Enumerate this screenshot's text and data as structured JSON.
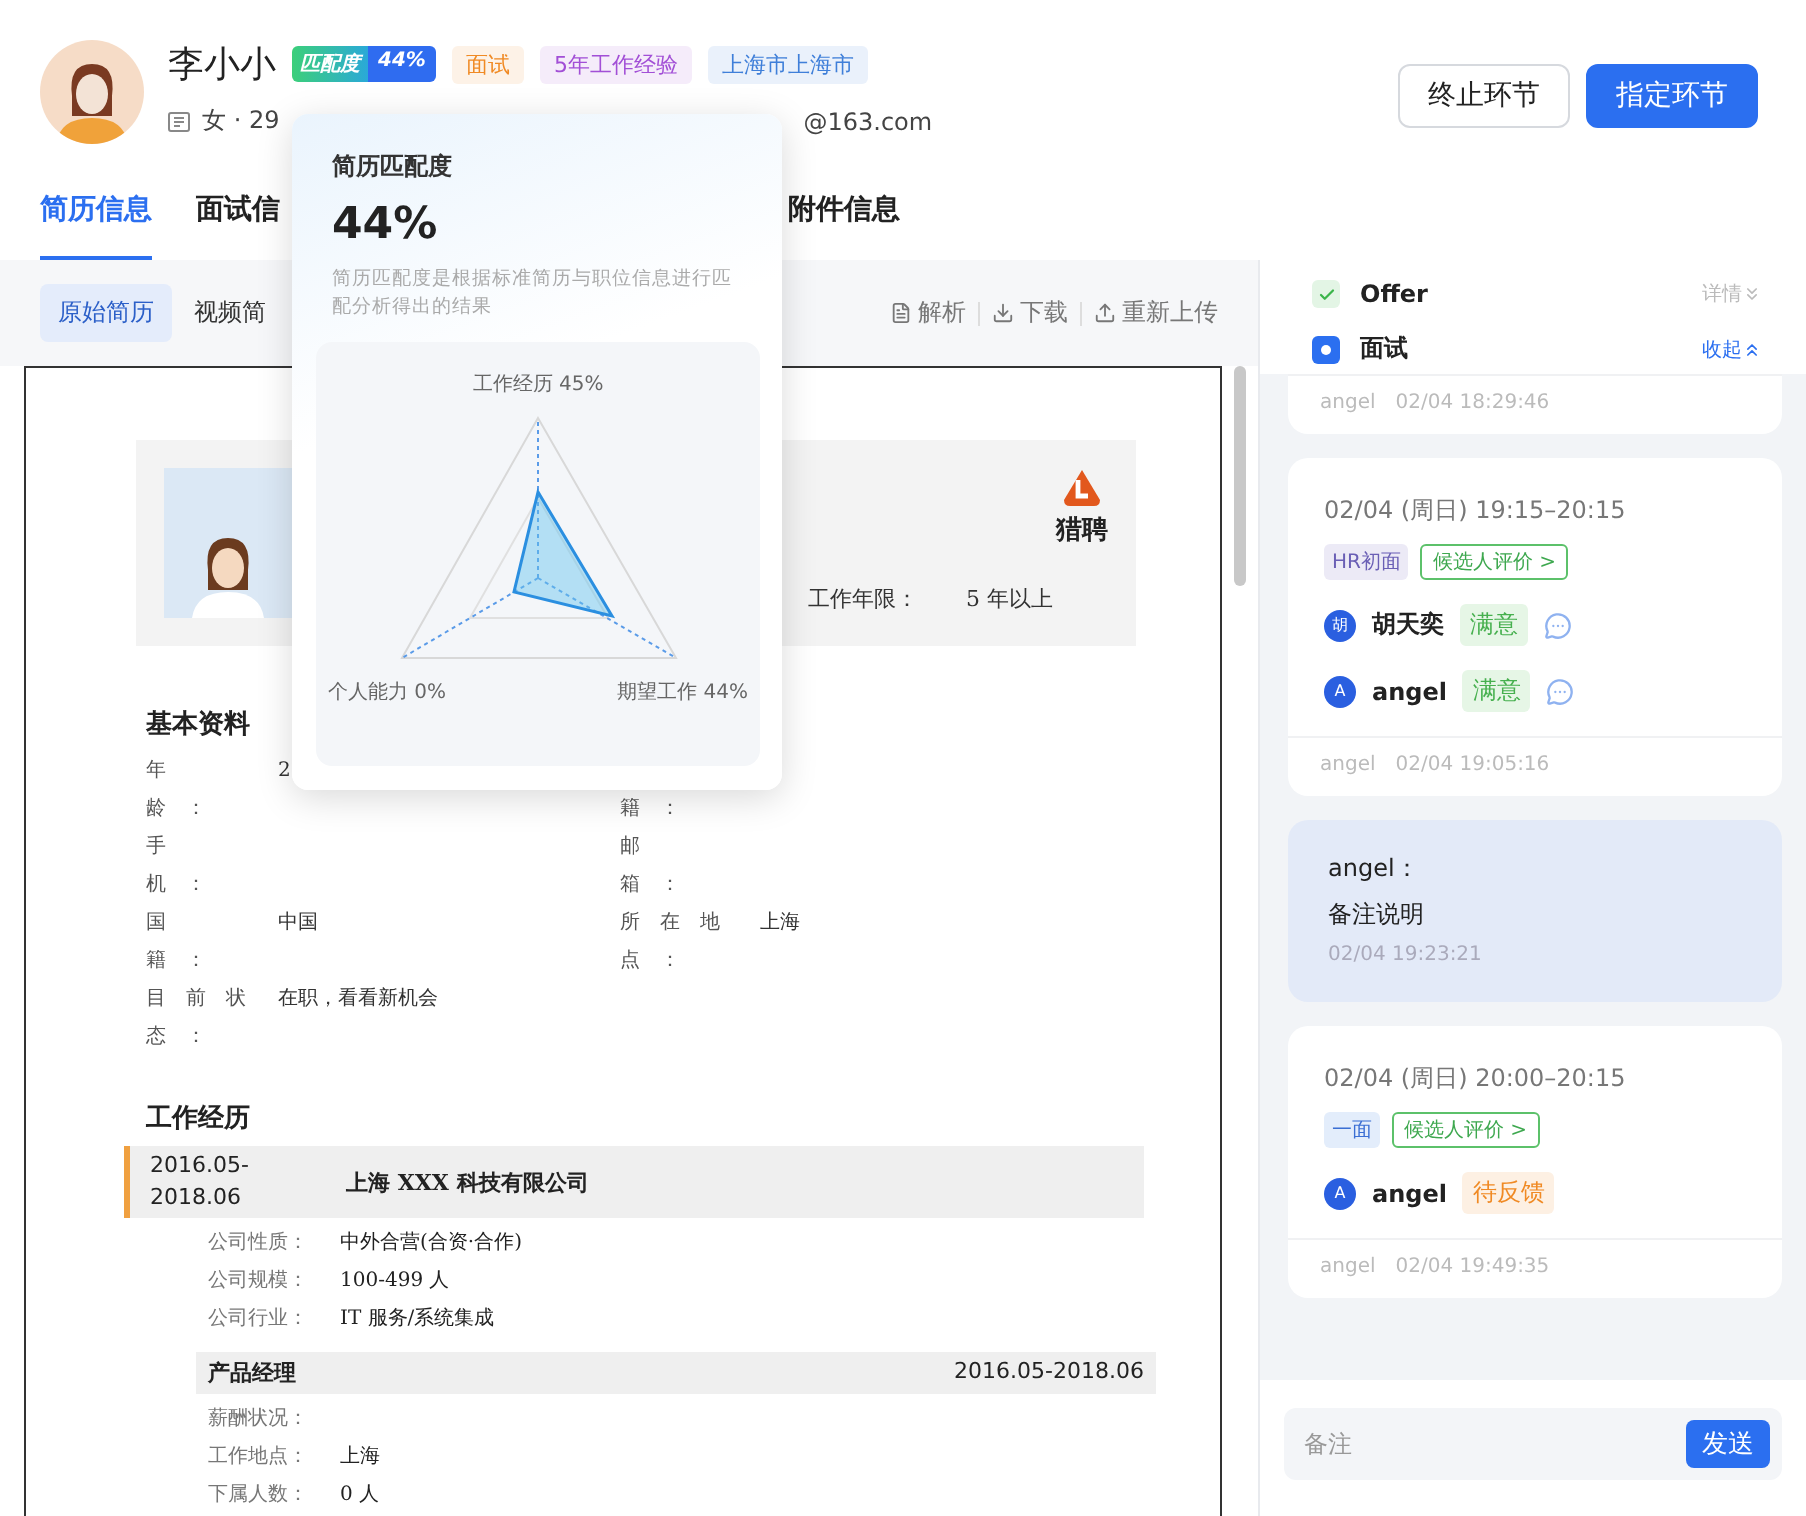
{
  "candidate": {
    "name": "李小小",
    "match_badge": {
      "label": "匹配度",
      "value": "44%"
    },
    "tags": [
      {
        "label": "面试",
        "color": "#f08a24"
      },
      {
        "label": "5年工作经验",
        "color": "#a24fd6"
      },
      {
        "label": "上海市上海市",
        "color": "#3f7fd9"
      }
    ],
    "info": "女 · 29",
    "email": "@163.com"
  },
  "actions": [
    {
      "label": "终止环节",
      "kind": "secondary"
    },
    {
      "label": "指定环节",
      "kind": "primary"
    }
  ],
  "tabs": [
    {
      "label": "简历信息",
      "selected": true
    },
    {
      "label": "面试信",
      "selected": false
    },
    {
      "label": "附件信息",
      "selected": false
    }
  ],
  "sub_tabs": [
    {
      "label": "原始简历",
      "selected": true
    },
    {
      "label": "视频简",
      "selected": false
    }
  ],
  "doc_actions": [
    {
      "label": "解析",
      "kind": "parse"
    },
    {
      "label": "下载",
      "kind": "download"
    },
    {
      "label": "重新上传",
      "kind": "upload"
    }
  ],
  "match_popover": {
    "title": "简历匹配度",
    "value": "44%",
    "description": "简历匹配度是根据标准简历与职位信息进行匹配分析得出的结果",
    "axes": [
      {
        "label": "工作经历 45%"
      },
      {
        "label": "个人能力 0%"
      },
      {
        "label": "期望工作 44%"
      }
    ]
  },
  "resume": {
    "logo_text": "猎聘",
    "work_years": {
      "label": "工作年限：",
      "value": "5 年以上"
    },
    "basic_title": "基本资料",
    "basic_info": [
      {
        "label": "年龄：",
        "value": "2"
      },
      {
        "label": "籍：",
        "top_hidden": true
      },
      {
        "label": "手机："
      },
      {
        "label": "邮箱："
      },
      {
        "label": "国籍：",
        "value": "中国"
      },
      {
        "label": "所在地点：",
        "value": "上海"
      },
      {
        "label": "目前状态：",
        "value": "在职，看看新机会"
      }
    ],
    "work_title": "工作经历",
    "job": {
      "period": "2016.05-2018.06",
      "company": "上海 XXX 科技有限公司",
      "company_info": [
        {
          "label": "公司性质：",
          "value": "中外合营(合资·合作)"
        },
        {
          "label": "公司规模：",
          "value": "100-499 人"
        },
        {
          "label": "公司行业：",
          "value": "IT 服务/系统集成"
        }
      ],
      "position": "产品经理",
      "position_period": "2016.05-2018.06",
      "position_info": [
        {
          "label": "薪酬状况："
        },
        {
          "label": "工作地点：",
          "value": "上海"
        },
        {
          "label": "下属人数：",
          "value": "0 人"
        }
      ]
    }
  },
  "timeline": [
    {
      "label": "Offer",
      "kind": "done",
      "toggle": "详情",
      "expanded": false
    },
    {
      "label": "面试",
      "kind": "current",
      "toggle": "收起",
      "expanded": true
    }
  ],
  "records": [
    {
      "kind": "interview",
      "partial": true,
      "author": "angel",
      "time": "02/04 18:29:46"
    },
    {
      "kind": "interview",
      "date": "02/04 (周日) 19:15–20:15",
      "round": {
        "label": "HR初面",
        "kind": "hr"
      },
      "review_link": "候选人评价 >",
      "reviewers": [
        {
          "avatar": "胡",
          "name": "胡天奕",
          "status": "满意",
          "kind": "good"
        },
        {
          "avatar": "A",
          "name": "angel",
          "status": "满意",
          "kind": "good"
        }
      ],
      "author": "angel",
      "time": "02/04 19:05:16"
    },
    {
      "kind": "note",
      "author": "angel：",
      "text": "备注说明",
      "time": "02/04 19:23:21"
    },
    {
      "kind": "interview",
      "date": "02/04 (周日) 20:00–20:15",
      "round": {
        "label": "一面",
        "kind": "first"
      },
      "review_link": "候选人评价 >",
      "reviewers": [
        {
          "avatar": "A",
          "name": "angel",
          "status": "待反馈",
          "kind": "pending"
        }
      ],
      "author": "angel",
      "time": "02/04 19:49:35"
    }
  ],
  "note_input": {
    "placeholder": "备注",
    "button": "发送"
  }
}
